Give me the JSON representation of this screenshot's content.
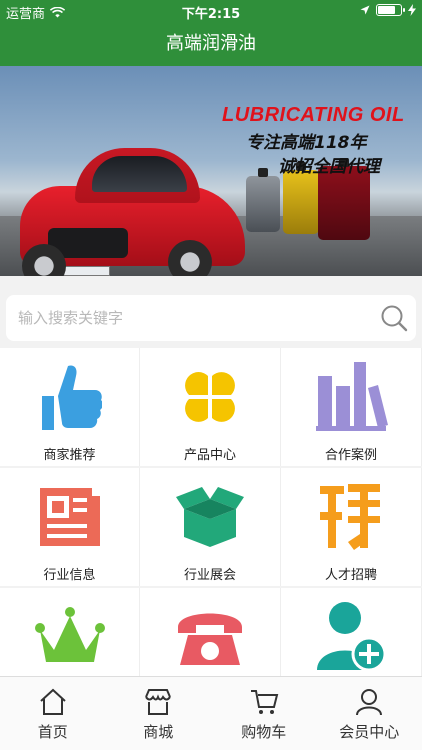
{
  "status": {
    "carrier": "运营商",
    "time": "下午2:15"
  },
  "nav": {
    "title": "高端润滑油"
  },
  "banner": {
    "headline1": "LUBRICATING OIL",
    "headline2": "专注高端118年",
    "headline3": "诚招全国代理"
  },
  "search": {
    "placeholder": "输入搜索关键字"
  },
  "grid": [
    {
      "label": "商家推荐",
      "icon": "thumbs-up-icon"
    },
    {
      "label": "产品中心",
      "icon": "clover-icon"
    },
    {
      "label": "合作案例",
      "icon": "books-icon"
    },
    {
      "label": "行业信息",
      "icon": "newspaper-icon"
    },
    {
      "label": "行业展会",
      "icon": "open-box-icon"
    },
    {
      "label": "人才招聘",
      "icon": "recruit-icon"
    },
    {
      "label": "",
      "icon": "crown-icon"
    },
    {
      "label": "",
      "icon": "telephone-icon"
    },
    {
      "label": "",
      "icon": "add-user-icon"
    }
  ],
  "tabs": [
    {
      "label": "首页",
      "icon": "home-icon"
    },
    {
      "label": "商城",
      "icon": "store-icon"
    },
    {
      "label": "购物车",
      "icon": "cart-icon"
    },
    {
      "label": "会员中心",
      "icon": "user-icon"
    }
  ],
  "colors": {
    "brand": "#2f8f3a"
  }
}
